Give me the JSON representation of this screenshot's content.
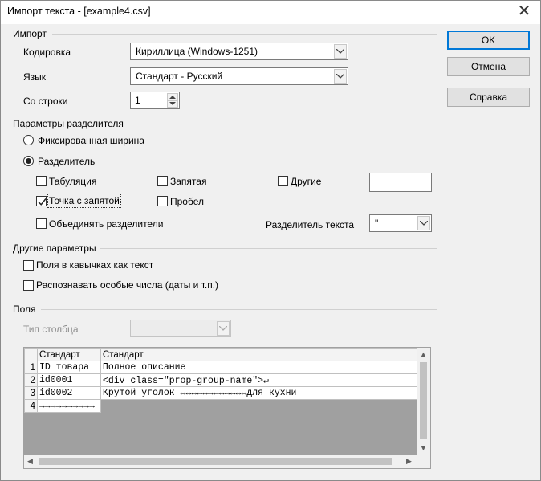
{
  "window": {
    "title": "Импорт текста - [example4.csv]",
    "close_glyph": "✕"
  },
  "import": {
    "section": "Импорт",
    "encoding_label": "Кодировка",
    "encoding_value": "Кириллица (Windows-1251)",
    "language_label": "Язык",
    "language_value": "Стандарт - Русский",
    "from_row_label": "Со строки",
    "from_row_value": "1"
  },
  "buttons": {
    "ok": "OK",
    "cancel": "Отмена",
    "help": "Справка"
  },
  "separator": {
    "section": "Параметры разделителя",
    "fixed_width": "Фиксированная ширина",
    "separated_by": "Разделитель",
    "fixed_width_checked": false,
    "separated_by_checked": true,
    "tab": "Табуляция",
    "comma": "Запятая",
    "other": "Другие",
    "semicolon": "Точка с запятой",
    "space": "Пробел",
    "merge": "Объединять разделители",
    "string_delimiter_label": "Разделитель текста",
    "string_delimiter_value": "\"",
    "checks": {
      "tab": false,
      "comma": false,
      "other": false,
      "semicolon": true,
      "space": false,
      "merge": false
    },
    "other_value": ""
  },
  "other_options": {
    "section": "Другие параметры",
    "quoted_as_text": "Поля в кавычках как текст",
    "detect_special_numbers": "Распознавать особые числа (даты и т.п.)",
    "quoted_as_text_checked": false,
    "detect_special_numbers_checked": false
  },
  "fields": {
    "section": "Поля",
    "column_type_label": "Тип столбца",
    "column_type_value": "",
    "headers": [
      "",
      "Стандарт",
      "Стандарт"
    ],
    "rows": [
      [
        "1",
        "ID товара",
        "Полное описание"
      ],
      [
        "2",
        "id0001",
        "<div class=\"prop-group-name\">↵"
      ],
      [
        "3",
        "id0002",
        "Крутой уголок ↔↔↔↔↔↔↔↔↔↔↔↔для кухни"
      ],
      [
        "4",
        "→→→→→→→→→→",
        ""
      ]
    ]
  }
}
